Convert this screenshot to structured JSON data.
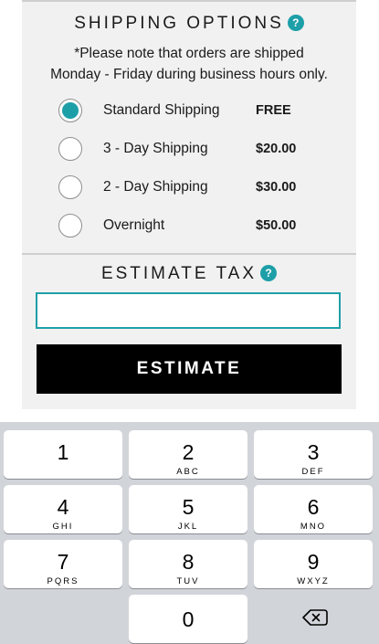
{
  "shipping": {
    "title": "SHIPPING OPTIONS",
    "help": "?",
    "note_line1": "*Please note that orders are shipped",
    "note_line2": "Monday - Friday during business hours only.",
    "options": [
      {
        "label": "Standard Shipping",
        "price": "FREE",
        "selected": true
      },
      {
        "label": "3 - Day Shipping",
        "price": "$20.00",
        "selected": false
      },
      {
        "label": "2 - Day Shipping",
        "price": "$30.00",
        "selected": false
      },
      {
        "label": "Overnight",
        "price": "$50.00",
        "selected": false
      }
    ]
  },
  "tax": {
    "title": "ESTIMATE TAX",
    "help": "?",
    "input_value": "",
    "button_label": "ESTIMATE"
  },
  "keypad": {
    "keys": [
      {
        "digit": "1",
        "letters": ""
      },
      {
        "digit": "2",
        "letters": "ABC"
      },
      {
        "digit": "3",
        "letters": "DEF"
      },
      {
        "digit": "4",
        "letters": "GHI"
      },
      {
        "digit": "5",
        "letters": "JKL"
      },
      {
        "digit": "6",
        "letters": "MNO"
      },
      {
        "digit": "7",
        "letters": "PQRS"
      },
      {
        "digit": "8",
        "letters": "TUV"
      },
      {
        "digit": "9",
        "letters": "WXYZ"
      },
      {
        "digit": "0",
        "letters": ""
      }
    ],
    "backspace_icon": "backspace-icon"
  },
  "colors": {
    "accent": "#1d9fa8",
    "button": "#000000",
    "panel": "#f1f1f1",
    "keyboard": "#d1d4d9"
  }
}
